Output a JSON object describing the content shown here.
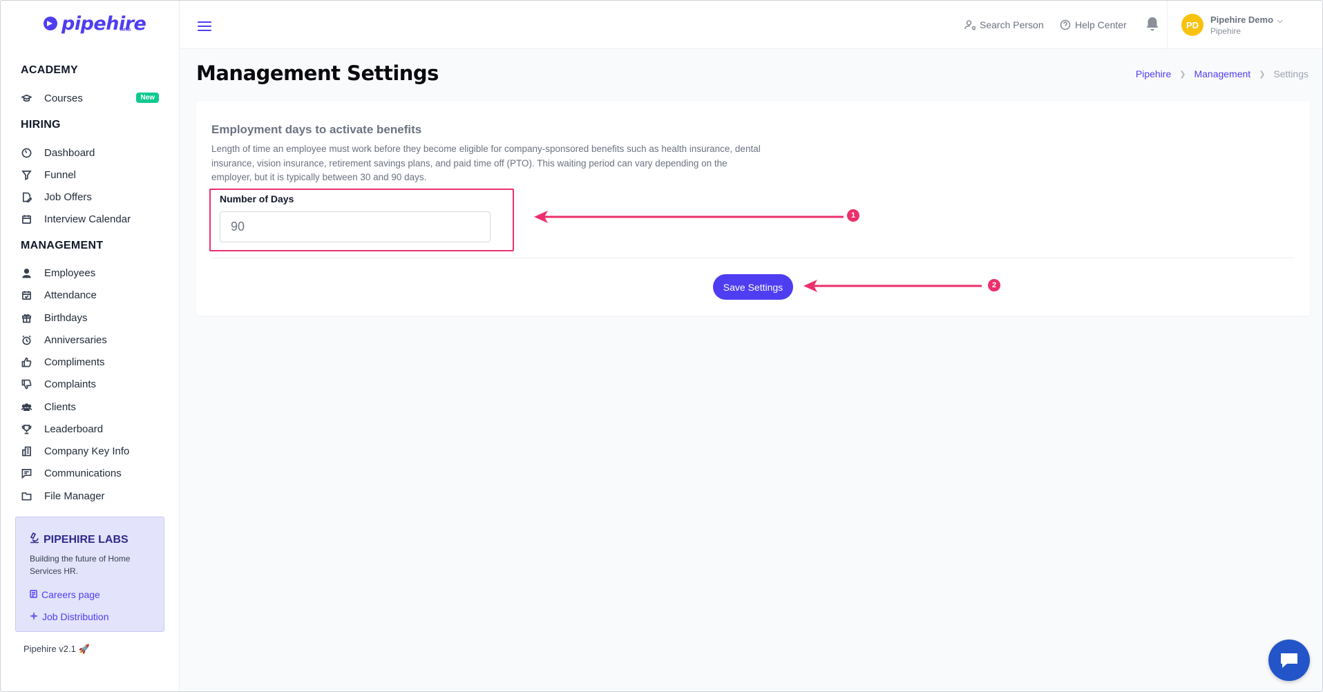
{
  "brand": {
    "logo_text": "pipehire",
    "logo_sub": "hrm",
    "accent_color": "#4f3df2",
    "highlight_color": "#ec2f6b"
  },
  "sidebar": {
    "sections": [
      {
        "title": "ACADEMY"
      },
      {
        "title": "HIRING"
      },
      {
        "title": "MANAGEMENT"
      }
    ],
    "academy_items": [
      {
        "label": "Courses",
        "icon": "graduation-cap-icon",
        "badge": "New"
      }
    ],
    "hiring_items": [
      {
        "label": "Dashboard",
        "icon": "gauge-icon"
      },
      {
        "label": "Funnel",
        "icon": "filter-icon"
      },
      {
        "label": "Job Offers",
        "icon": "document-edit-icon"
      },
      {
        "label": "Interview Calendar",
        "icon": "calendar-icon"
      }
    ],
    "management_items": [
      {
        "label": "Employees",
        "icon": "person-icon"
      },
      {
        "label": "Attendance",
        "icon": "calendar-check-icon"
      },
      {
        "label": "Birthdays",
        "icon": "gift-icon"
      },
      {
        "label": "Anniversaries",
        "icon": "alarm-clock-icon"
      },
      {
        "label": "Compliments",
        "icon": "thumbs-up-icon"
      },
      {
        "label": "Complaints",
        "icon": "thumbs-down-icon"
      },
      {
        "label": "Clients",
        "icon": "people-icon"
      },
      {
        "label": "Leaderboard",
        "icon": "trophy-icon"
      },
      {
        "label": "Company Key Info",
        "icon": "building-icon"
      },
      {
        "label": "Communications",
        "icon": "chat-icon"
      },
      {
        "label": "File Manager",
        "icon": "folder-icon"
      }
    ],
    "labs": {
      "title": "PIPEHIRE LABS",
      "description": "Building the future of Home Services HR.",
      "links": [
        {
          "label": "Careers page",
          "icon": "list-icon"
        },
        {
          "label": "Job Distribution",
          "icon": "share-nodes-icon"
        }
      ]
    },
    "version": "Pipehire v2.1 🚀"
  },
  "header": {
    "search_person": "Search Person",
    "help_center": "Help Center",
    "user": {
      "initials": "PD",
      "name": "Pipehire Demo",
      "org": "Pipehire",
      "avatar_color": "#f8c20c"
    }
  },
  "page": {
    "title": "Management Settings",
    "breadcrumb": [
      {
        "label": "Pipehire"
      },
      {
        "label": "Management"
      },
      {
        "label": "Settings"
      }
    ]
  },
  "settings_card": {
    "title": "Employment days to activate benefits",
    "description": "Length of time an employee must work before they become eligible for company-sponsored benefits such as health insurance, dental insurance, vision insurance, retirement savings plans, and paid time off (PTO). This waiting period can vary depending on the employer, but it is typically between 30 and 90 days.",
    "field_label": "Number of Days",
    "field_value": "90",
    "save_label": "Save Settings"
  },
  "annotations": [
    {
      "number": "1"
    },
    {
      "number": "2"
    }
  ]
}
